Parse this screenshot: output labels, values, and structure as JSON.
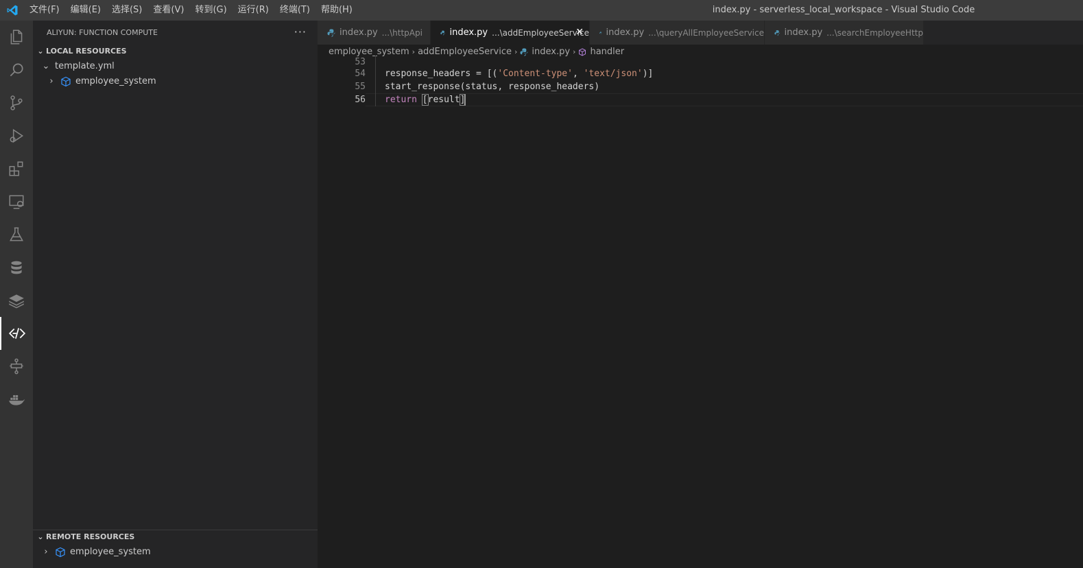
{
  "titlebar": {
    "menus": [
      "文件(F)",
      "编辑(E)",
      "选择(S)",
      "查看(V)",
      "转到(G)",
      "运行(R)",
      "终端(T)",
      "帮助(H)"
    ],
    "window_title": "index.py - serverless_local_workspace - Visual Studio Code"
  },
  "activitybar": {
    "items": [
      "explorer-icon",
      "search-icon",
      "source-control-icon",
      "run-debug-icon",
      "extensions-icon",
      "remote-explorer-icon",
      "testing-icon",
      "database-icon",
      "layers-icon",
      "function-compute-icon",
      "flow-icon",
      "docker-icon"
    ],
    "active": "function-compute-icon"
  },
  "sidebar": {
    "title": "ALIYUN: FUNCTION COMPUTE",
    "more": "···",
    "local": {
      "header": "LOCAL RESOURCES",
      "template": "template.yml",
      "service": "employee_system"
    },
    "remote": {
      "header": "REMOTE RESOURCES",
      "service": "employee_system"
    }
  },
  "tabs": [
    {
      "name": "index.py",
      "desc": "...\\httpApi",
      "active": false
    },
    {
      "name": "index.py",
      "desc": "...\\addEmployeeService",
      "active": true
    },
    {
      "name": "index.py",
      "desc": "...\\queryAllEmployeeService",
      "active": false
    },
    {
      "name": "index.py",
      "desc": "...\\searchEmployeeHttp",
      "active": false
    }
  ],
  "breadcrumb": {
    "folder": "employee_system",
    "subfolder": "addEmployeeService",
    "file": "index.py",
    "symbol": "handler"
  },
  "code": {
    "lines": [
      {
        "num": "53",
        "text": ""
      },
      {
        "num": "54",
        "pre": "response_headers = [(",
        "s1": "'Content-type'",
        "mid": ", ",
        "s2": "'text/json'",
        "post": ")]"
      },
      {
        "num": "55",
        "text": "start_response(status, response_headers)"
      },
      {
        "num": "56",
        "kw": "return",
        "open": "[",
        "body": "result",
        "close": "]"
      }
    ]
  },
  "colors": {
    "accent": "#007acc",
    "python_icon": "#519aba",
    "keyword": "#c586c0",
    "string": "#ce9178"
  }
}
